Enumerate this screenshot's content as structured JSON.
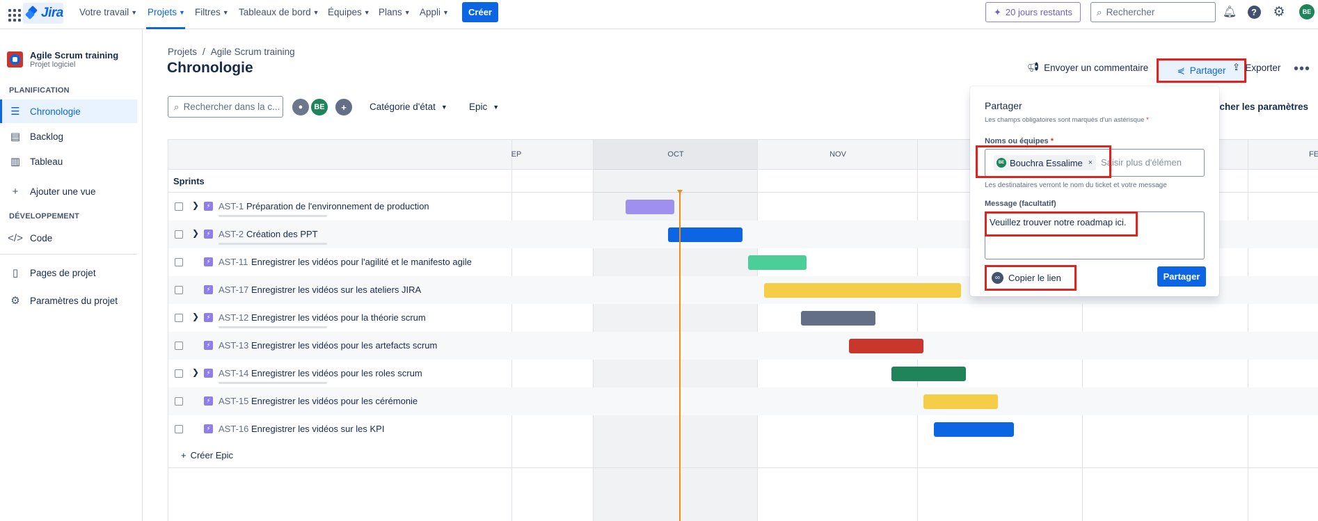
{
  "nav": {
    "logo": "Jira",
    "items": [
      "Votre travail",
      "Projets",
      "Filtres",
      "Tableaux de bord",
      "Équipes",
      "Plans",
      "Appli"
    ],
    "create_label": "Créer",
    "trial_label": "20 jours restants",
    "search_placeholder": "Rechercher",
    "user_initials": "BE"
  },
  "sidebar": {
    "project_name": "Agile Scrum training",
    "project_type": "Projet logiciel",
    "section_planning": "PLANIFICATION",
    "item_timeline": "Chronologie",
    "item_backlog": "Backlog",
    "item_board": "Tableau",
    "item_add_view": "Ajouter une vue",
    "section_dev": "DÉVELOPPEMENT",
    "item_code": "Code",
    "item_pages": "Pages de projet",
    "item_settings": "Paramètres du projet"
  },
  "header": {
    "breadcrumb_root": "Projets",
    "breadcrumb_sep": "/",
    "breadcrumb_project": "Agile Scrum training",
    "title": "Chronologie",
    "feedback_label": "Envoyer un commentaire",
    "share_label": "Partager",
    "export_label": "Exporter",
    "more_label": "•••"
  },
  "filters": {
    "search_placeholder": "Rechercher dans la c...",
    "avatar_initials": "BE",
    "status_category": "Catégorie d'état",
    "epic": "Epic",
    "show_params": "Afficher les paramètres"
  },
  "timeline": {
    "months": [
      "EP",
      "OCT",
      "NOV",
      "FE"
    ],
    "sprints_label": "Sprints",
    "create_epic": "Créer Epic",
    "rows": [
      {
        "key": "AST-1",
        "title": "Préparation de l'environnement de production",
        "color": "#9f8fef"
      },
      {
        "key": "AST-2",
        "title": "Création des PPT",
        "color": "#0c66e4"
      },
      {
        "key": "AST-11",
        "title": "Enregistrer les vidéos pour l'agilité et le manifesto agile",
        "color": "#4bce97"
      },
      {
        "key": "AST-17",
        "title": "Enregistrer les vidéos sur les ateliers JIRA",
        "color": "#f5cd47"
      },
      {
        "key": "AST-12",
        "title": "Enregistrer les vidéos pour la théorie scrum",
        "color": "#626f86"
      },
      {
        "key": "AST-13",
        "title": "Enregistrer les vidéos pour les artefacts scrum",
        "color": "#c9372c"
      },
      {
        "key": "AST-14",
        "title": "Enregistrer les vidéos pour les roles scrum",
        "color": "#1f845a"
      },
      {
        "key": "AST-15",
        "title": "Enregistrer les vidéos pour les cérémonie",
        "color": "#f5cd47"
      },
      {
        "key": "AST-16",
        "title": "Enregistrer les vidéos sur les KPI",
        "color": "#0c66e4"
      }
    ]
  },
  "share_popup": {
    "title": "Partager",
    "required_note": "Les champs obligatoires sont marqués d'un astérisque",
    "required_mark": "*",
    "names_label": "Noms ou équipes",
    "recipient_initials": "BE",
    "recipient_name": "Bouchra Essalime",
    "recipient_remove": "×",
    "names_placeholder": "Saisir plus d'élémen",
    "hint": "Les destinataires verront le nom du ticket et votre message",
    "message_label": "Message (facultatif)",
    "message_value": "Veuillez trouver notre roadmap ici.",
    "copy_link_label": "Copier le lien",
    "share_button_label": "Partager"
  }
}
